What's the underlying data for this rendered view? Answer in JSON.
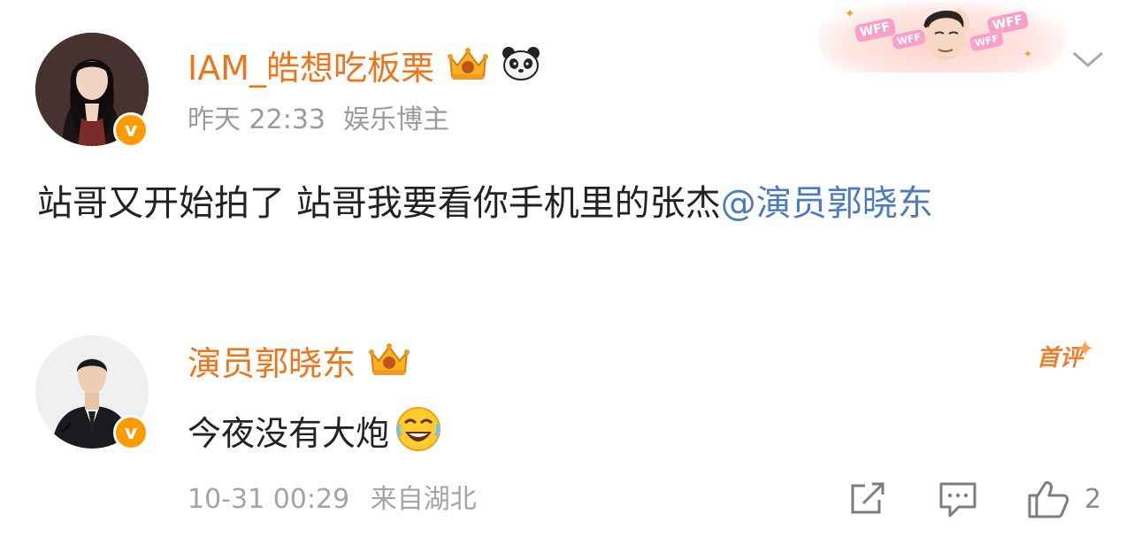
{
  "post": {
    "username": "IAM_皓想吃板栗",
    "time": "昨天 22:33",
    "identity": "娱乐博主",
    "text": "站哥又开始拍了 站哥我要看你手机里的张杰",
    "mention": "@演员郭晓东",
    "verified_badge": "v",
    "icons": [
      "crown-badge-icon",
      "panda-emoji-icon",
      "chevron-down-icon"
    ],
    "banner_tags": [
      "WFF",
      "WFF",
      "WFF",
      "WFF"
    ]
  },
  "reply": {
    "username": "演员郭晓东",
    "text": "今夜没有大炮",
    "first_comment_tag": "首评",
    "verified_badge": "v",
    "time": "10-31 00:29",
    "location": "来自湖北",
    "like_count": "2",
    "icons": [
      "crown-badge-icon",
      "laughing-emoji-icon",
      "share-icon",
      "comment-icon",
      "like-icon"
    ]
  },
  "colors": {
    "username": "#f0751a",
    "mention": "#4d7bbf",
    "meta": "#9b9b9b",
    "verified": "#ff9a00"
  }
}
